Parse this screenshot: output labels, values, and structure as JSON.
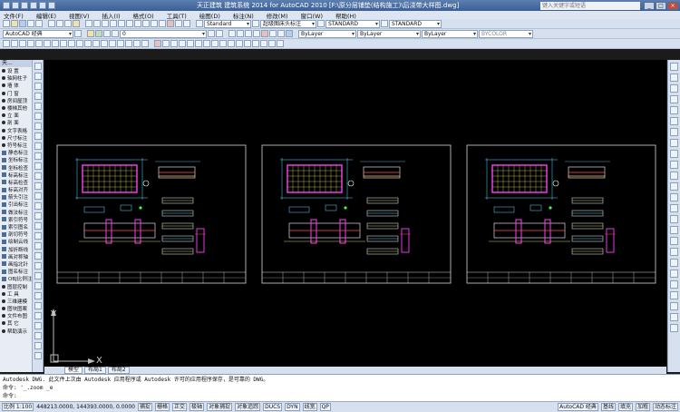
{
  "window": {
    "title": "天正建筑 建筑系统 2014  for AutoCAD 2010    [F:\\原分层铺垫(结构施工)\\后浇带大样图.dwg]",
    "search_placeholder": "键入关键字或短语"
  },
  "menu": [
    "文件(F)",
    "编辑(E)",
    "视图(V)",
    "插入(I)",
    "格式(O)",
    "工具(T)",
    "绘图(D)",
    "标注(N)",
    "修改(M)",
    "窗口(W)",
    "帮助(H)"
  ],
  "toolbar": {
    "text_style": "Standard",
    "annot_style": "超级图床头标注",
    "table_style": "STANDARD",
    "multileader_style": "STANDARD",
    "workspace": "AutoCAD 经典",
    "layer": "0",
    "color": "ByLayer",
    "linetype": "ByLayer",
    "lineweight": "ByLayer",
    "plot_style": "BYCOLOR"
  },
  "left_panel": {
    "header": "天...",
    "items": [
      {
        "label": "设   置",
        "group": true
      },
      {
        "label": "轴网柱子",
        "group": true
      },
      {
        "label": "墙   体",
        "group": true
      },
      {
        "label": "门   窗",
        "group": true
      },
      {
        "label": "房间屋顶",
        "group": true
      },
      {
        "label": "楼梯其他",
        "group": true
      },
      {
        "label": "立   面",
        "group": true
      },
      {
        "label": "剖   面",
        "group": true
      },
      {
        "label": "文字表格",
        "group": true
      },
      {
        "label": "尺寸标注",
        "group": true
      },
      {
        "label": "符号标注",
        "group": true
      },
      {
        "label": "静态标注",
        "group": false
      },
      {
        "label": "坐标标注",
        "group": false
      },
      {
        "label": "坐标检查",
        "group": false
      },
      {
        "label": "标高标注",
        "group": false
      },
      {
        "label": "标高检查",
        "group": false
      },
      {
        "label": "标高对齐",
        "group": false
      },
      {
        "label": "箭头引注",
        "group": false
      },
      {
        "label": "引出标注",
        "group": false
      },
      {
        "label": "做法标注",
        "group": false
      },
      {
        "label": "索引符号",
        "group": false
      },
      {
        "label": "索引图名",
        "group": false
      },
      {
        "label": "剖切符号",
        "group": false
      },
      {
        "label": "绘制云线",
        "group": false
      },
      {
        "label": "加折断线",
        "group": false
      },
      {
        "label": "画对称轴",
        "group": false
      },
      {
        "label": "画指北针",
        "group": false
      },
      {
        "label": "图名标注",
        "group": false
      },
      {
        "label": "OBJ比例注",
        "group": false
      },
      {
        "label": "图层控制",
        "group": true
      },
      {
        "label": "工   具",
        "group": true
      },
      {
        "label": "三维建模",
        "group": true
      },
      {
        "label": "图块图案",
        "group": true
      },
      {
        "label": "文件布图",
        "group": true
      },
      {
        "label": "其   它",
        "group": true
      },
      {
        "label": "帮助演示",
        "group": true
      }
    ]
  },
  "ucs": {
    "x": "X",
    "y": "Y"
  },
  "tabs": [
    "模型",
    "布局1",
    "布局2"
  ],
  "command_lines": [
    "Autodesk DWG.  此文件上次由 Autodesk 应用程序或 Autodesk 许可的应用程序保存，是可靠的 DWG。",
    "命令: '_.zoom _e",
    "命令:"
  ],
  "status": {
    "scale": "比例 1:100",
    "coords": "448213.0000, 144393.0000, 0.0000",
    "toggles": [
      "捕捉",
      "栅格",
      "正交",
      "极轴",
      "对象捕捉",
      "对象追踪",
      "DUCS",
      "DYN",
      "线宽",
      "QP"
    ],
    "workspace": "AutoCAD 经典",
    "right_buttons": [
      "基线",
      "填充",
      "加粗",
      "动态标注"
    ]
  },
  "colors": {
    "canvas": "#000000",
    "chrome": "#d6e0ee",
    "titlebar": "#3b5f95"
  }
}
